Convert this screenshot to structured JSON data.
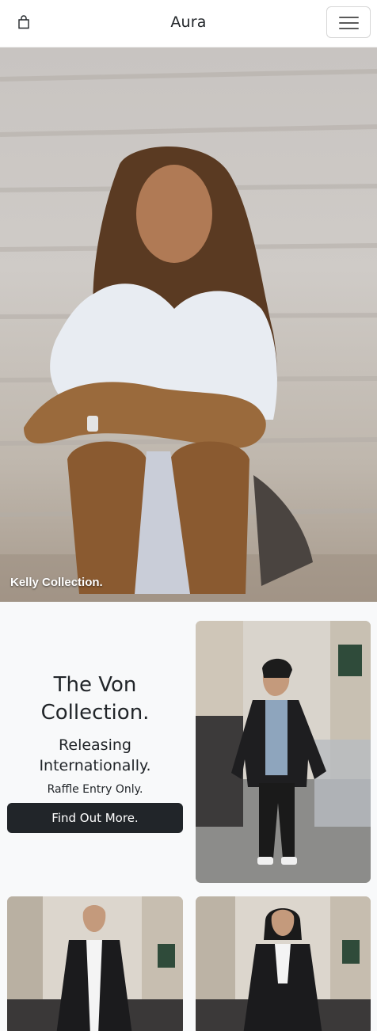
{
  "navbar": {
    "brand": "Aura",
    "cart_icon": "shopping-bag-icon",
    "menu_icon": "hamburger-menu-icon"
  },
  "hero": {
    "caption": "Kelly Collection."
  },
  "collection": {
    "title": "The Von Collection.",
    "subtitle": "Releasing Internationally.",
    "note": "Raffle Entry Only.",
    "cta_label": "Find Out More."
  },
  "colors": {
    "accent": "#212529",
    "section_background": "#f8f9fa"
  }
}
